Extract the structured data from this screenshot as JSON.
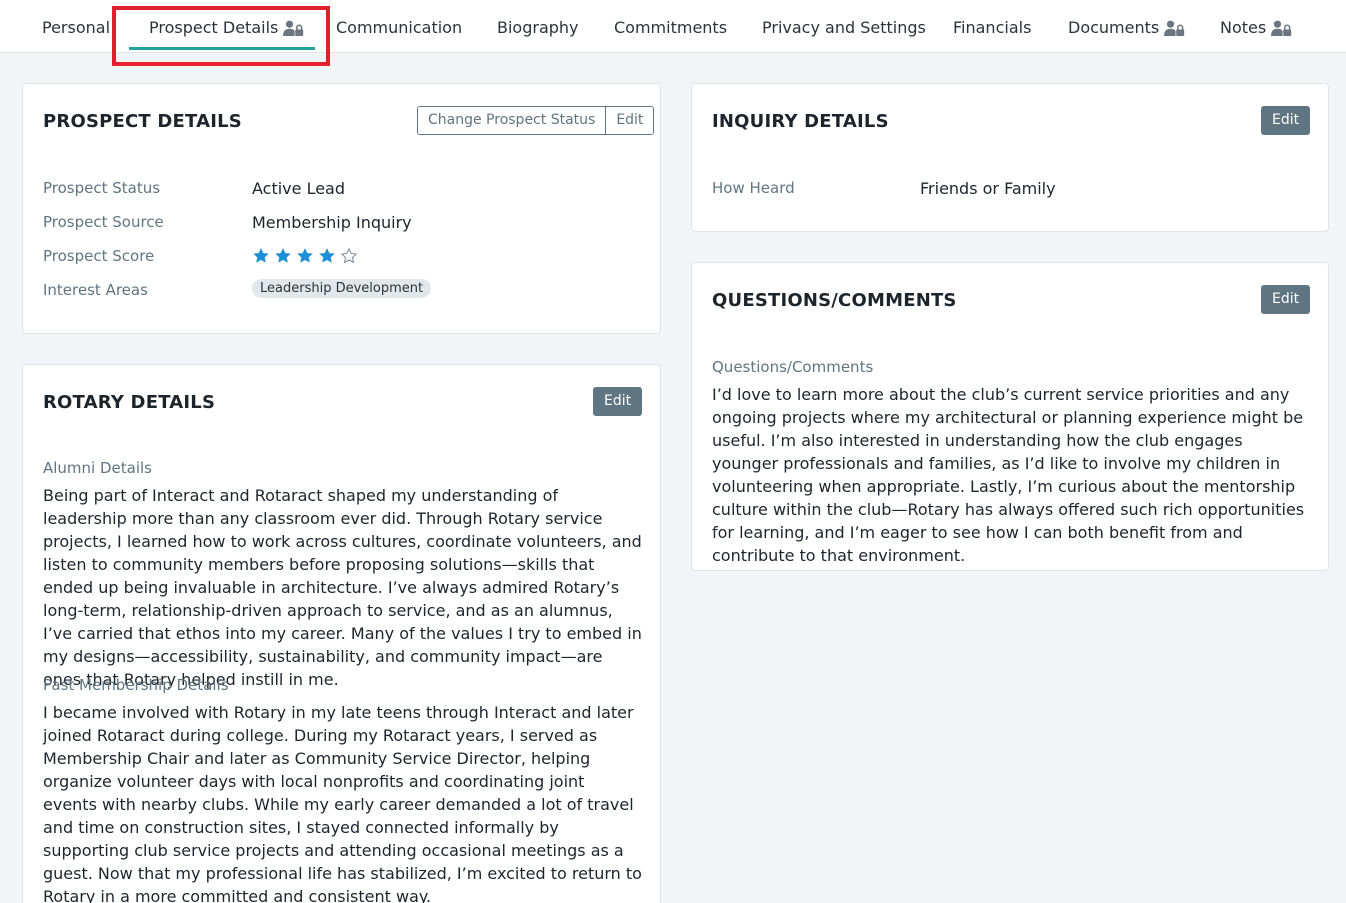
{
  "tabs": [
    {
      "label": "Personal"
    },
    {
      "label": "Prospect Details",
      "locked": true,
      "active": true
    },
    {
      "label": "Communication"
    },
    {
      "label": "Biography"
    },
    {
      "label": "Commitments"
    },
    {
      "label": "Privacy and Settings"
    },
    {
      "label": "Financials"
    },
    {
      "label": "Documents",
      "locked": true
    },
    {
      "label": "Notes",
      "locked": true
    }
  ],
  "prospect": {
    "title": "PROSPECT DETAILS",
    "change_status_label": "Change Prospect Status",
    "edit_label": "Edit",
    "fields": [
      {
        "label": "Prospect Status",
        "value": "Active Lead"
      },
      {
        "label": "Prospect Source",
        "value": "Membership Inquiry"
      },
      {
        "label": "Prospect Score",
        "rating": 4,
        "max": 5
      },
      {
        "label": "Interest Areas",
        "chip": "Leadership Development"
      }
    ]
  },
  "rotary": {
    "title": "ROTARY DETAILS",
    "edit_label": "Edit",
    "alumni_label": "Alumni Details",
    "alumni_text": "Being part of Interact and Rotaract shaped my understanding of leadership more than any classroom ever did. Through Rotary service projects, I learned how to work across cultures, coordinate volunteers, and listen to community members before proposing solutions—skills that ended up being invaluable in architecture. I’ve always admired Rotary’s long-term, relationship-driven approach to service, and as an alumnus, I’ve carried that ethos into my career. Many of the values I try to embed in my designs—accessibility, sustainability, and community impact—are ones that Rotary helped instill in me.",
    "past_label": "Past Membership Details",
    "past_text": "I became involved with Rotary in my late teens through Interact and later joined Rotaract during college. During my Rotaract years, I served as Membership Chair and later as Community Service Director, helping organize volunteer days with local nonprofits and coordinating joint events with nearby clubs. While my early career demanded a lot of travel and time on construction sites, I stayed connected informally by supporting club service projects and attending occasional meetings as a guest. Now that my professional life has stabilized, I’m excited to return to Rotary in a more committed and consistent way."
  },
  "inquiry": {
    "title": "INQUIRY DETAILS",
    "edit_label": "Edit",
    "how_heard_label": "How Heard",
    "how_heard_value": "Friends or Family"
  },
  "questions": {
    "title": "QUESTIONS/COMMENTS",
    "edit_label": "Edit",
    "label": "Questions/Comments",
    "text": "I’d love to learn more about the club’s current service priorities and any ongoing projects where my architectural or planning experience might be useful. I’m also interested in understanding how the club engages younger professionals and families, as I’d like to involve my children in volunteering when appropriate. Lastly, I’m curious about the mentorship culture within the club—Rotary has always offered such rich opportunities for learning, and I’m eager to see how I can both benefit from and contribute to that environment."
  },
  "colors": {
    "accent": "#23a19c",
    "button": "#5f7682",
    "star": "#1a8fd6",
    "highlight": "#e0202b"
  }
}
